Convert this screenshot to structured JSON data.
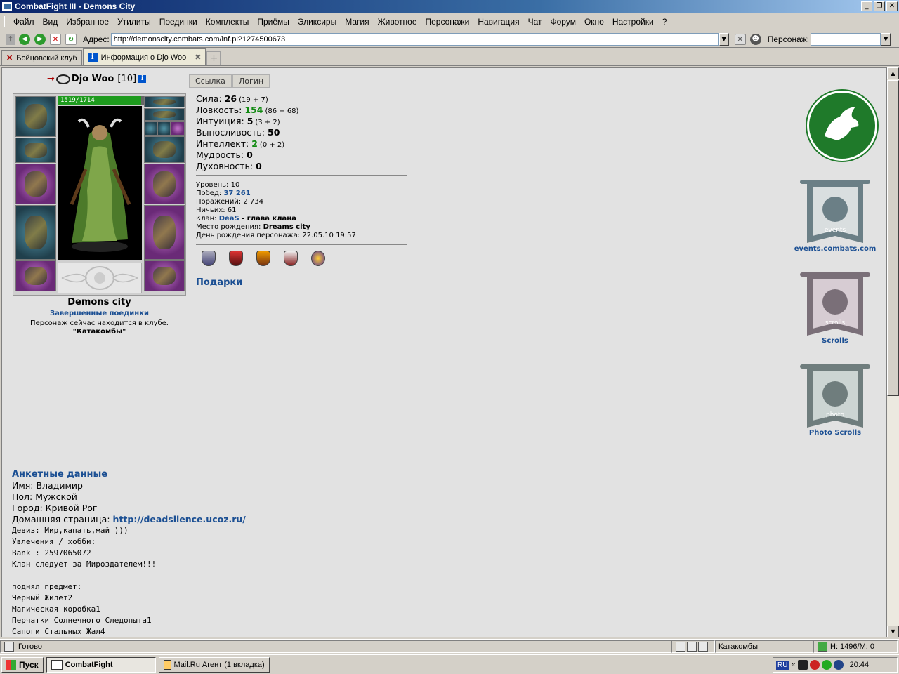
{
  "window": {
    "title": "CombatFight III - Demons City",
    "minimize": "_",
    "restore": "❐",
    "close": "✕"
  },
  "menu": [
    "Файл",
    "Вид",
    "Избранное",
    "Утилиты",
    "Поединки",
    "Комплекты",
    "Приёмы",
    "Эликсиры",
    "Магия",
    "Животное",
    "Персонажи",
    "Навигация",
    "Чат",
    "Форум",
    "Окно",
    "Настройки",
    "?"
  ],
  "address": {
    "label": "Адрес:",
    "value": "http://demonscity.combats.com/inf.pl?1274500673",
    "persona_label": "Персонаж:"
  },
  "tabs": [
    {
      "label": "Бойцовский клуб",
      "active": false
    },
    {
      "label": "Информация о Djo Woo",
      "active": true
    }
  ],
  "character": {
    "name": "Djo Woo",
    "level": "[10]",
    "hp": "1519/1714",
    "hp_fraction": 0.886,
    "city": "Demons city",
    "fights_link": "Завершенные поединки",
    "location_note": "Персонаж сейчас находится в клубе.",
    "location_name": "\"Катакомбы\""
  },
  "buttons": {
    "link": "Ссылка",
    "login": "Логин"
  },
  "stats": [
    {
      "label": "Сила:",
      "value": "26",
      "bonus": "(19 + 7)",
      "green": false
    },
    {
      "label": "Ловкость:",
      "value": "154",
      "bonus": "(86 + 68)",
      "green": true
    },
    {
      "label": "Интуиция:",
      "value": "5",
      "bonus": "(3 + 2)",
      "green": false
    },
    {
      "label": "Выносливость:",
      "value": "50",
      "bonus": "",
      "green": false
    },
    {
      "label": "Интеллект:",
      "value": "2",
      "bonus": "(0 + 2)",
      "green": true
    },
    {
      "label": "Мудрость:",
      "value": "0",
      "bonus": "",
      "green": false
    },
    {
      "label": "Духовность:",
      "value": "0",
      "bonus": "",
      "green": false
    }
  ],
  "info": {
    "level": "Уровень: 10",
    "wins_label": "Побед:",
    "wins": "37 261",
    "losses": "Поражений: 2 734",
    "draws": "Ничьих: 61",
    "clan_label": "Клан:",
    "clan": "DeaS",
    "clan_role": "- глава клана",
    "birthplace_label": "Место рождения:",
    "birthplace": "Dreams city",
    "birthday": "День рождения персонажа: 22.05.10 19:57"
  },
  "gifts": "Подарки",
  "banners": [
    {
      "label": "events.combats.com",
      "text": "events"
    },
    {
      "label": "Scrolls",
      "text": "scrolls"
    },
    {
      "label": "Photo Scrolls",
      "text": "photo"
    }
  ],
  "profile": {
    "title": "Анкетные данные",
    "name": "Имя: Владимир",
    "gender": "Пол: Мужской",
    "city": "Город: Кривой Рог",
    "homepage_label": "Домашняя страница:",
    "homepage": "http://deadsilence.ucoz.ru/",
    "lines": [
      "Девиз: Мир,капать,май )))",
      "Увлечения / хобби:",
      "Bank : 2597065072",
      "Клан следует за Мироздателем!!!",
      "",
      "поднял предмет:",
      "Черный Жилет2",
      "Магическая коробка1",
      "Перчатки Солнечного Следопыта1",
      "Сапоги Стальных Жал4"
    ]
  },
  "status": {
    "text": "Готово",
    "location": "Катакомбы",
    "counter": "H: 1496/M: 0"
  },
  "taskbar": {
    "start": "Пуск",
    "task1": "CombatFight",
    "task2": "Mail.Ru Агент (1 вкладка)",
    "lang": "RU",
    "time": "20:44"
  }
}
